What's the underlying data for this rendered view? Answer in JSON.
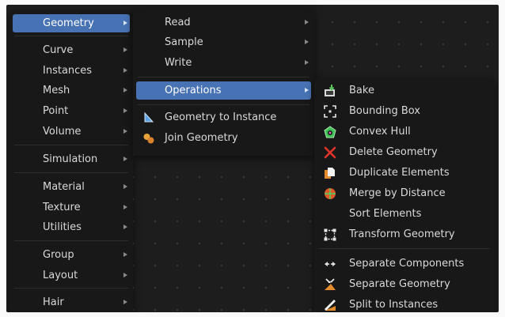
{
  "category_menu": {
    "items": [
      {
        "label": "Geometry",
        "active": true
      },
      {
        "label": "Curve"
      },
      {
        "label": "Instances"
      },
      {
        "label": "Mesh"
      },
      {
        "label": "Point"
      },
      {
        "label": "Volume"
      },
      {
        "label": "Simulation"
      },
      {
        "label": "Material"
      },
      {
        "label": "Texture"
      },
      {
        "label": "Utilities"
      },
      {
        "label": "Group"
      },
      {
        "label": "Layout"
      },
      {
        "label": "Hair"
      }
    ]
  },
  "geometry_menu": {
    "items": [
      {
        "label": "Read"
      },
      {
        "label": "Sample"
      },
      {
        "label": "Write"
      },
      {
        "label": "Operations",
        "active": true
      },
      {
        "label": "Geometry to Instance",
        "icon": "geometry-to-instance-icon"
      },
      {
        "label": "Join Geometry",
        "icon": "join-geometry-icon"
      }
    ]
  },
  "operations_menu": {
    "items": [
      {
        "label": "Bake",
        "icon": "bake-icon"
      },
      {
        "label": "Bounding Box",
        "icon": "bounding-box-icon"
      },
      {
        "label": "Convex Hull",
        "icon": "convex-hull-icon"
      },
      {
        "label": "Delete Geometry",
        "icon": "delete-icon"
      },
      {
        "label": "Duplicate Elements",
        "icon": "duplicate-icon"
      },
      {
        "label": "Merge by Distance",
        "icon": "merge-icon"
      },
      {
        "label": "Sort Elements"
      },
      {
        "label": "Transform Geometry",
        "icon": "transform-icon"
      },
      {
        "label": "Separate Components",
        "icon": "separate-components-icon"
      },
      {
        "label": "Separate Geometry",
        "icon": "separate-geometry-icon"
      },
      {
        "label": "Split to Instances",
        "icon": "split-instances-icon"
      }
    ]
  },
  "colors": {
    "background": "#1d1d1d",
    "menu": "#181818",
    "highlight": "#4772b3",
    "text": "#d9d9d9"
  }
}
